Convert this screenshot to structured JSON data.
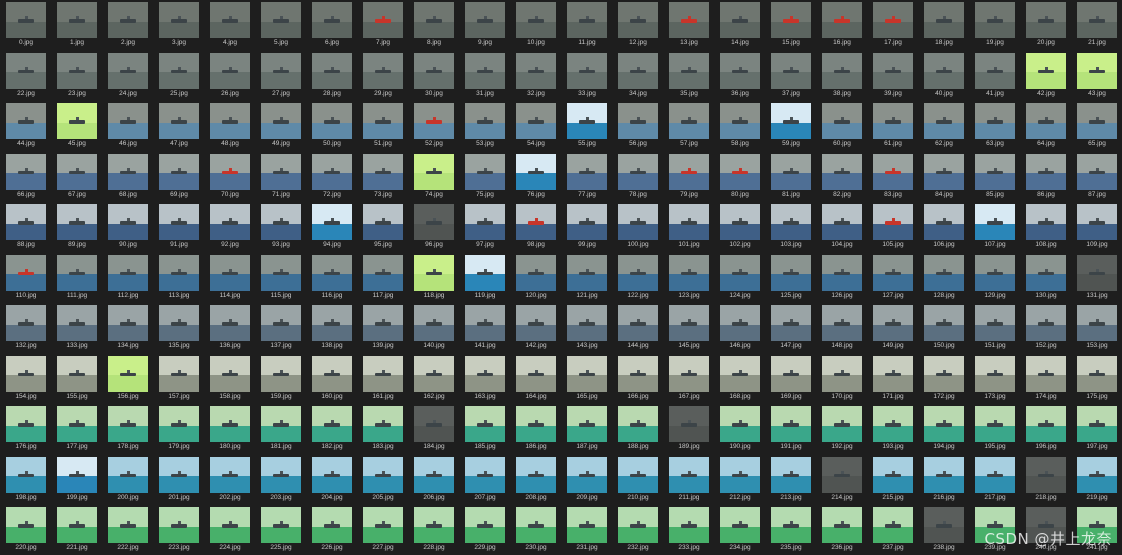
{
  "gallery": {
    "columns": 22,
    "extension": ".jpg",
    "files": [
      "0.jpg",
      "1.jpg",
      "2.jpg",
      "3.jpg",
      "4.jpg",
      "5.jpg",
      "6.jpg",
      "7.jpg",
      "8.jpg",
      "9.jpg",
      "10.jpg",
      "11.jpg",
      "12.jpg",
      "13.jpg",
      "14.jpg",
      "15.jpg",
      "16.jpg",
      "17.jpg",
      "18.jpg",
      "19.jpg",
      "20.jpg",
      "21.jpg",
      "22.jpg",
      "23.jpg",
      "24.jpg",
      "25.jpg",
      "26.jpg",
      "27.jpg",
      "28.jpg",
      "29.jpg",
      "30.jpg",
      "31.jpg",
      "32.jpg",
      "33.jpg",
      "34.jpg",
      "35.jpg",
      "36.jpg",
      "37.jpg",
      "38.jpg",
      "39.jpg",
      "40.jpg",
      "41.jpg",
      "42.jpg",
      "43.jpg",
      "44.jpg",
      "45.jpg",
      "46.jpg",
      "47.jpg",
      "48.jpg",
      "49.jpg",
      "50.jpg",
      "51.jpg",
      "52.jpg",
      "53.jpg",
      "54.jpg",
      "55.jpg",
      "56.jpg",
      "57.jpg",
      "58.jpg",
      "59.jpg",
      "60.jpg",
      "61.jpg",
      "62.jpg",
      "63.jpg",
      "64.jpg",
      "65.jpg",
      "66.jpg",
      "67.jpg",
      "68.jpg",
      "69.jpg",
      "70.jpg",
      "71.jpg",
      "72.jpg",
      "73.jpg",
      "74.jpg",
      "75.jpg",
      "76.jpg",
      "77.jpg",
      "78.jpg",
      "79.jpg",
      "80.jpg",
      "81.jpg",
      "82.jpg",
      "83.jpg",
      "84.jpg",
      "85.jpg",
      "86.jpg",
      "87.jpg",
      "88.jpg",
      "89.jpg",
      "90.jpg",
      "91.jpg",
      "92.jpg",
      "93.jpg",
      "94.jpg",
      "95.jpg",
      "96.jpg",
      "97.jpg",
      "98.jpg",
      "99.jpg",
      "100.jpg",
      "101.jpg",
      "102.jpg",
      "103.jpg",
      "104.jpg",
      "105.jpg",
      "106.jpg",
      "107.jpg",
      "108.jpg",
      "109.jpg",
      "110.jpg",
      "111.jpg",
      "112.jpg",
      "113.jpg",
      "114.jpg",
      "115.jpg",
      "116.jpg",
      "117.jpg",
      "118.jpg",
      "119.jpg",
      "120.jpg",
      "121.jpg",
      "122.jpg",
      "123.jpg",
      "124.jpg",
      "125.jpg",
      "126.jpg",
      "127.jpg",
      "128.jpg",
      "129.jpg",
      "130.jpg",
      "131.jpg",
      "132.jpg",
      "133.jpg",
      "134.jpg",
      "135.jpg",
      "136.jpg",
      "137.jpg",
      "138.jpg",
      "139.jpg",
      "140.jpg",
      "141.jpg",
      "142.jpg",
      "143.jpg",
      "144.jpg",
      "145.jpg",
      "146.jpg",
      "147.jpg",
      "148.jpg",
      "149.jpg",
      "150.jpg",
      "151.jpg",
      "152.jpg",
      "153.jpg",
      "154.jpg",
      "155.jpg",
      "156.jpg",
      "157.jpg",
      "158.jpg",
      "159.jpg",
      "160.jpg",
      "161.jpg",
      "162.jpg",
      "163.jpg",
      "164.jpg",
      "165.jpg",
      "166.jpg",
      "167.jpg",
      "168.jpg",
      "169.jpg",
      "170.jpg",
      "171.jpg",
      "172.jpg",
      "173.jpg",
      "174.jpg",
      "175.jpg",
      "176.jpg",
      "177.jpg",
      "178.jpg",
      "179.jpg",
      "180.jpg",
      "181.jpg",
      "182.jpg",
      "183.jpg",
      "184.jpg",
      "185.jpg",
      "186.jpg",
      "187.jpg",
      "188.jpg",
      "189.jpg",
      "190.jpg",
      "191.jpg",
      "192.jpg",
      "193.jpg",
      "194.jpg",
      "195.jpg",
      "196.jpg",
      "197.jpg",
      "198.jpg",
      "199.jpg",
      "200.jpg",
      "201.jpg",
      "202.jpg",
      "203.jpg",
      "204.jpg",
      "205.jpg",
      "206.jpg",
      "207.jpg",
      "208.jpg",
      "209.jpg",
      "210.jpg",
      "211.jpg",
      "212.jpg",
      "213.jpg",
      "214.jpg",
      "215.jpg",
      "216.jpg",
      "217.jpg",
      "218.jpg",
      "219.jpg",
      "220.jpg",
      "221.jpg",
      "222.jpg",
      "223.jpg",
      "224.jpg",
      "225.jpg",
      "226.jpg",
      "227.jpg",
      "228.jpg",
      "229.jpg",
      "230.jpg",
      "231.jpg",
      "232.jpg",
      "233.jpg",
      "234.jpg",
      "235.jpg",
      "236.jpg",
      "237.jpg",
      "238.jpg",
      "239.jpg",
      "240.jpg",
      "241.jpg"
    ],
    "row_themes": [
      [
        "#6f7670",
        "#5c6560"
      ],
      [
        "#7b8480",
        "#65706c"
      ],
      [
        "#8a918c",
        "#5f8aa8"
      ],
      [
        "#9aa3a0",
        "#4f6f95"
      ],
      [
        "#b8c2c8",
        "#3f5f86"
      ],
      [
        "#8a9490",
        "#3d6f96"
      ],
      [
        "#9aa4a6",
        "#5b6f80"
      ],
      [
        "#c8cdbf",
        "#8e9486"
      ],
      [
        "#b9d9b0",
        "#3aa78a"
      ],
      [
        "#a7cfe0",
        "#2f8fb0"
      ],
      [
        "#b4dbb0",
        "#48b06a"
      ]
    ],
    "accent_colors": {
      "red_ship": "#c8352a",
      "green_tint": "#c9ef8a",
      "blue_sea": "#2a86b8"
    }
  },
  "watermark": "CSDN @井上龙奈"
}
